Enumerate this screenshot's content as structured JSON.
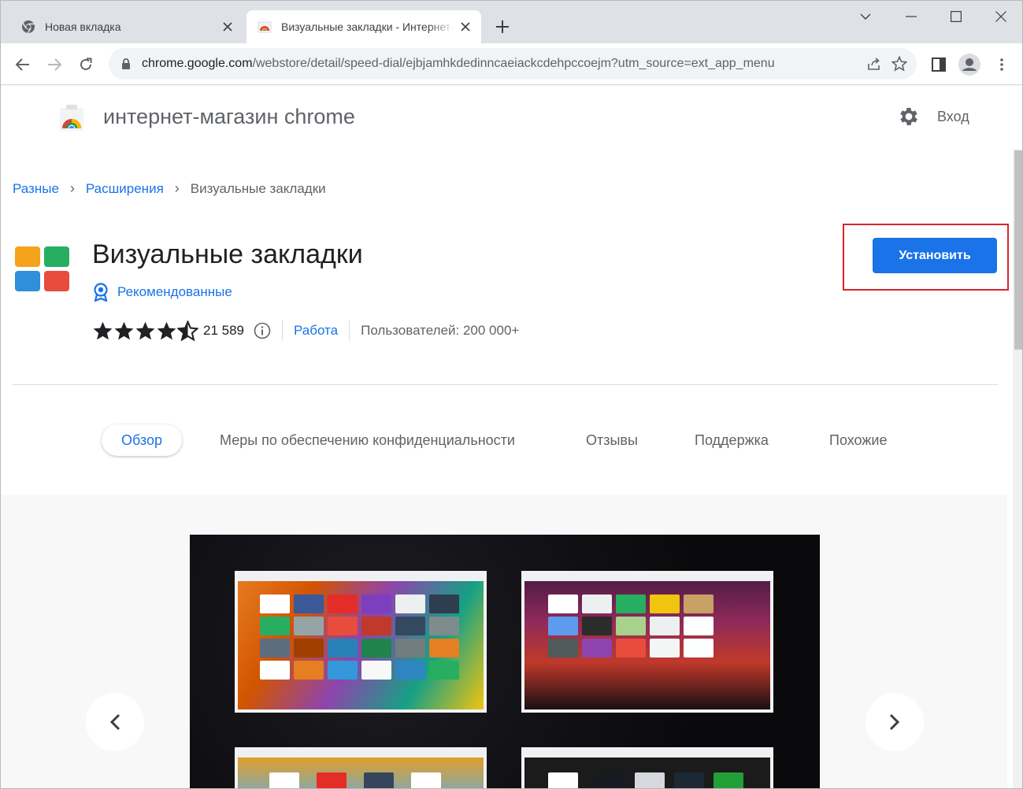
{
  "browser": {
    "tabs": [
      {
        "title": "Новая вкладка",
        "icon": "chrome-icon",
        "active": false
      },
      {
        "title": "Визуальные закладки - Интернет-магазин Chrome",
        "icon": "webstore-icon",
        "active": true
      }
    ],
    "url_host": "chrome.google.com",
    "url_rest": "/webstore/detail/speed-dial/ejbjamhkdedinncaeiackcdehpccoejm?utm_source=ext_app_menu"
  },
  "store": {
    "name": "интернет-магазин chrome",
    "signin": "Вход"
  },
  "breadcrumb": {
    "items": [
      "Разные",
      "Расширения"
    ],
    "current": "Визуальные закладки",
    "separator": "›"
  },
  "extension": {
    "title": "Визуальные закладки",
    "featured": "Рекомендованные",
    "rating_stars": 4.5,
    "rating_count": "21 589",
    "category": "Работа",
    "users": "Пользователей: 200 000+",
    "install_label": "Установить",
    "icon_colors": [
      "#f5a31a",
      "#27ae60",
      "#2f8fd8",
      "#e74c3c"
    ]
  },
  "detail_tabs": [
    {
      "label": "Обзор",
      "selected": true
    },
    {
      "label": "Меры по обеспечению конфиденциальности",
      "selected": false
    },
    {
      "label": "Отзывы",
      "selected": false
    },
    {
      "label": "Поддержка",
      "selected": false
    },
    {
      "label": "Похожие",
      "selected": false
    }
  ],
  "colors": {
    "accent": "#1a73e8",
    "highlight_border": "#d9252c",
    "tabstrip": "#dee1e6"
  }
}
